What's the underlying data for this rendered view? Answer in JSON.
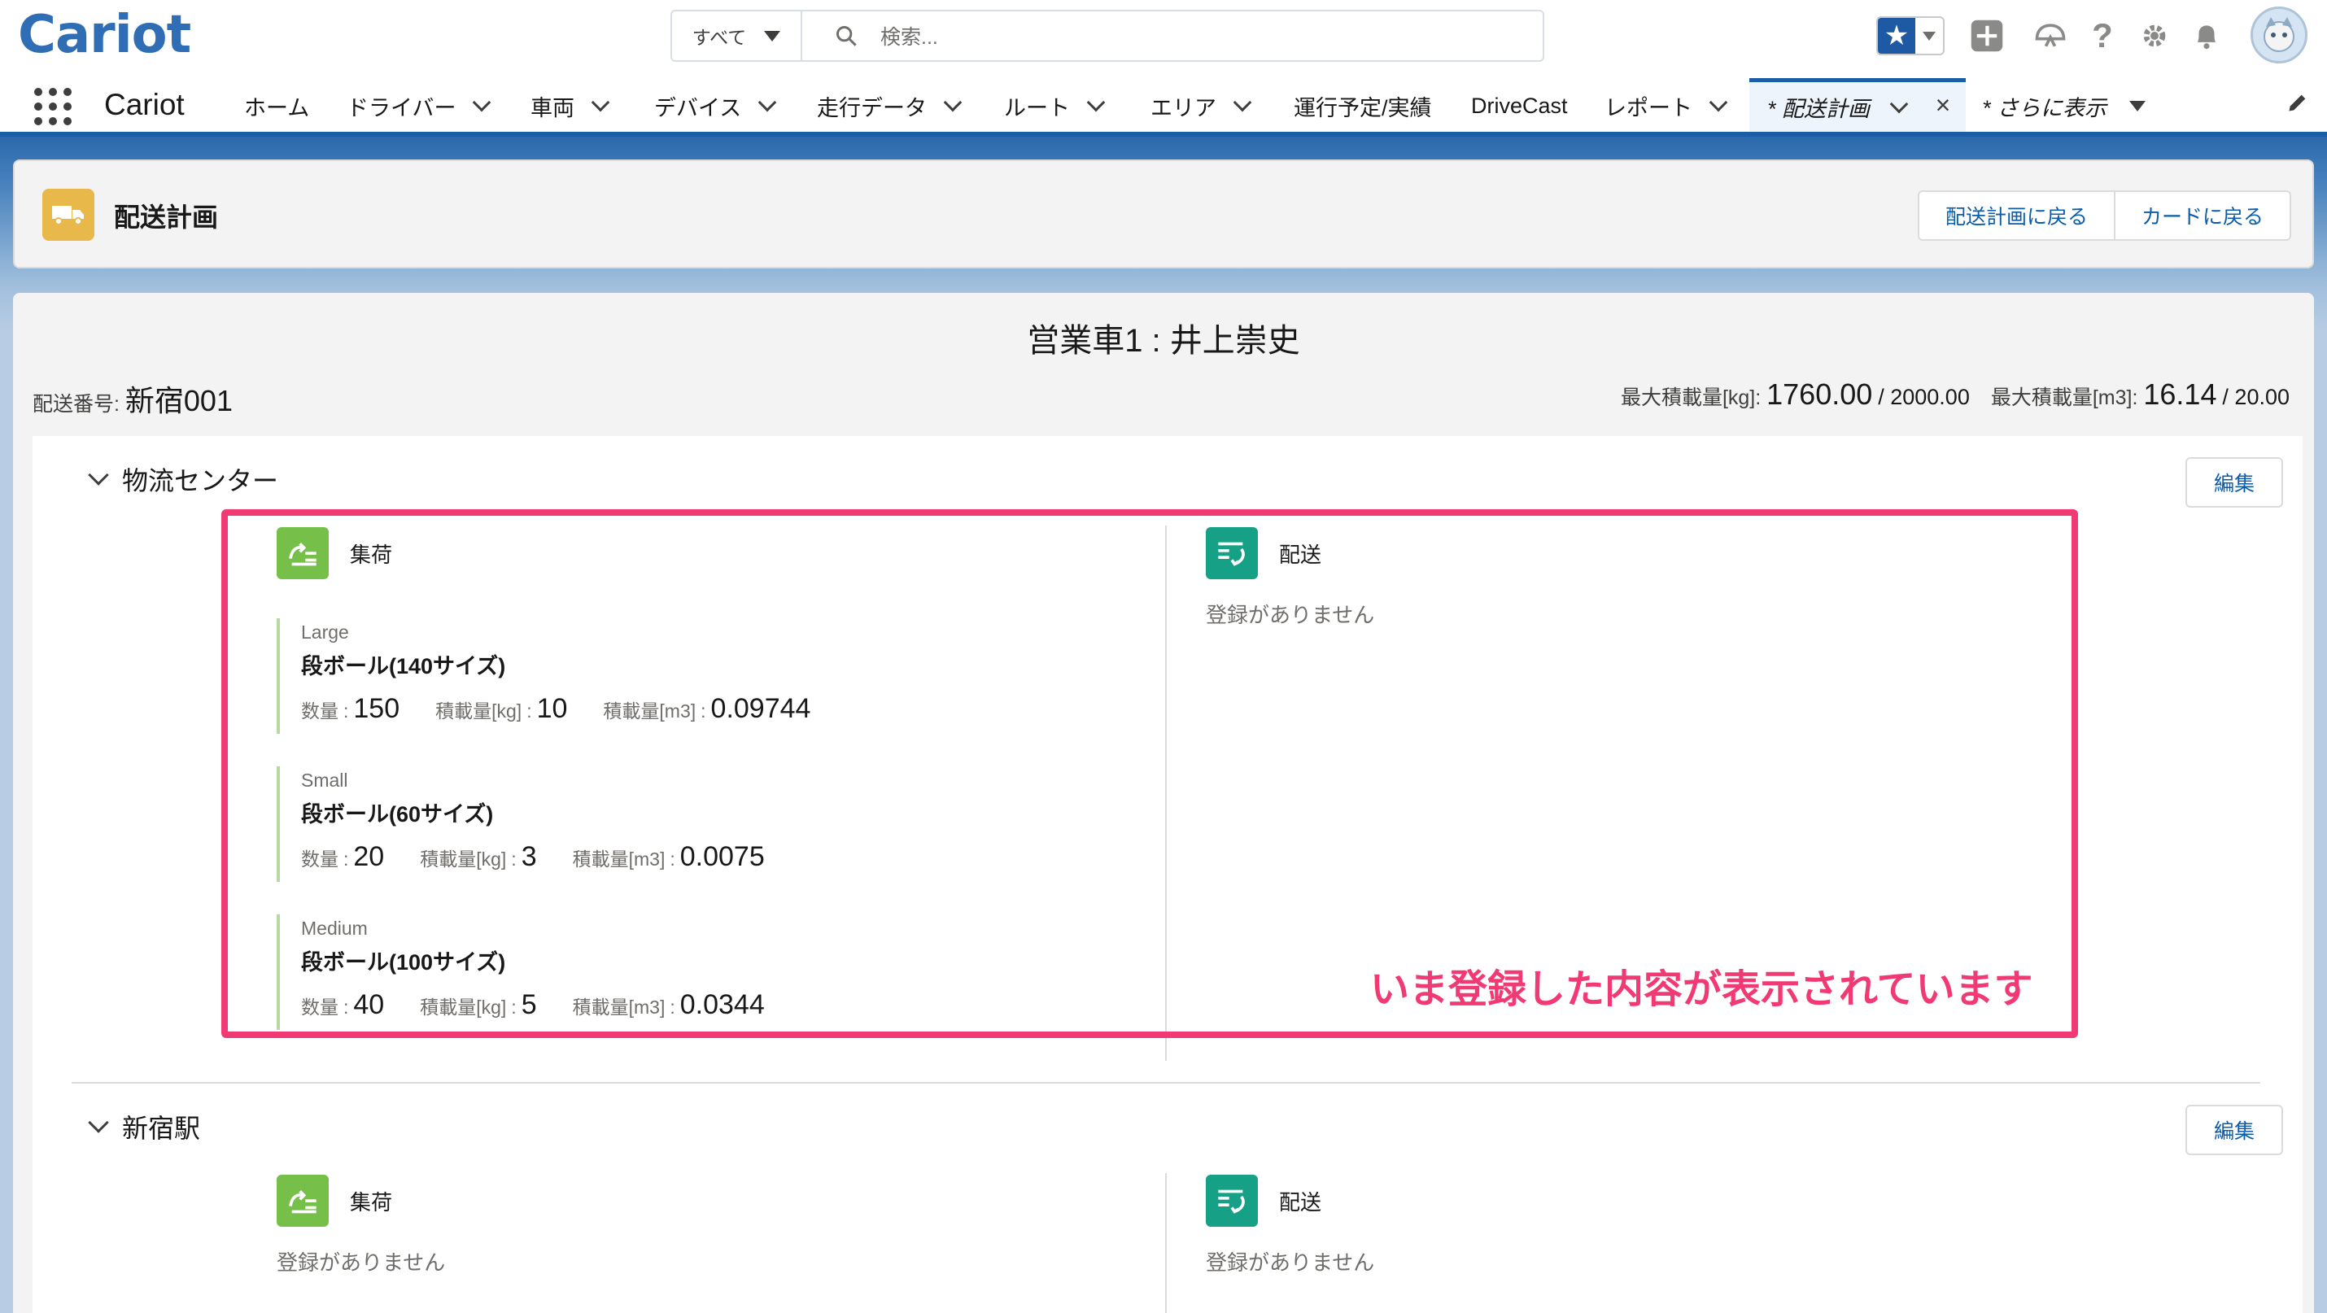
{
  "header": {
    "logo": "Cariot",
    "search_scope": "すべて",
    "search_placeholder": "検索..."
  },
  "nav": {
    "app_name": "Cariot",
    "items": [
      "ホーム",
      "ドライバー",
      "車両",
      "デバイス",
      "走行データ",
      "ルート",
      "エリア",
      "運行予定/実績",
      "DriveCast",
      "レポート"
    ],
    "active_tab": "* 配送計画",
    "more": "* さらに表示"
  },
  "page": {
    "title": "配送計画",
    "back_to_plan": "配送計画に戻る",
    "back_to_card": "カードに戻る"
  },
  "summary": {
    "vehicle_title": "営業車1 : 井上崇史",
    "delivery_no_label": "配送番号:",
    "delivery_no": "新宿001",
    "max_kg_label": "最大積載量[kg]:",
    "max_kg_value": "1760.00",
    "max_kg_total": "/ 2000.00",
    "max_m3_label": "最大積載量[m3]:",
    "max_m3_value": "16.14",
    "max_m3_total": "/ 20.00"
  },
  "sections": [
    {
      "name": "物流センター",
      "edit": "編集",
      "pickup_label": "集荷",
      "delivery_label": "配送",
      "delivery_empty": "登録がありません",
      "cargo": [
        {
          "size": "Large",
          "name": "段ボール(140サイズ)",
          "qty_label": "数量",
          "qty": "150",
          "kg_label": "積載量[kg]",
          "kg": "10",
          "m3_label": "積載量[m3]",
          "m3": "0.09744"
        },
        {
          "size": "Small",
          "name": "段ボール(60サイズ)",
          "qty_label": "数量",
          "qty": "20",
          "kg_label": "積載量[kg]",
          "kg": "3",
          "m3_label": "積載量[m3]",
          "m3": "0.0075"
        },
        {
          "size": "Medium",
          "name": "段ボール(100サイズ)",
          "qty_label": "数量",
          "qty": "40",
          "kg_label": "積載量[kg]",
          "kg": "5",
          "m3_label": "積載量[m3]",
          "m3": "0.0344"
        }
      ]
    },
    {
      "name": "新宿駅",
      "edit": "編集",
      "pickup_label": "集荷",
      "pickup_empty": "登録がありません",
      "delivery_label": "配送",
      "delivery_empty": "登録がありません"
    }
  ],
  "annotation": "いま登録した内容が表示されています",
  "colors": {
    "brand_blue": "#1b5ea7",
    "highlight_pink": "#f13a74",
    "pickup_green": "#76c04a",
    "delivery_teal": "#16a085",
    "page_icon_yellow": "#e9b84a"
  }
}
